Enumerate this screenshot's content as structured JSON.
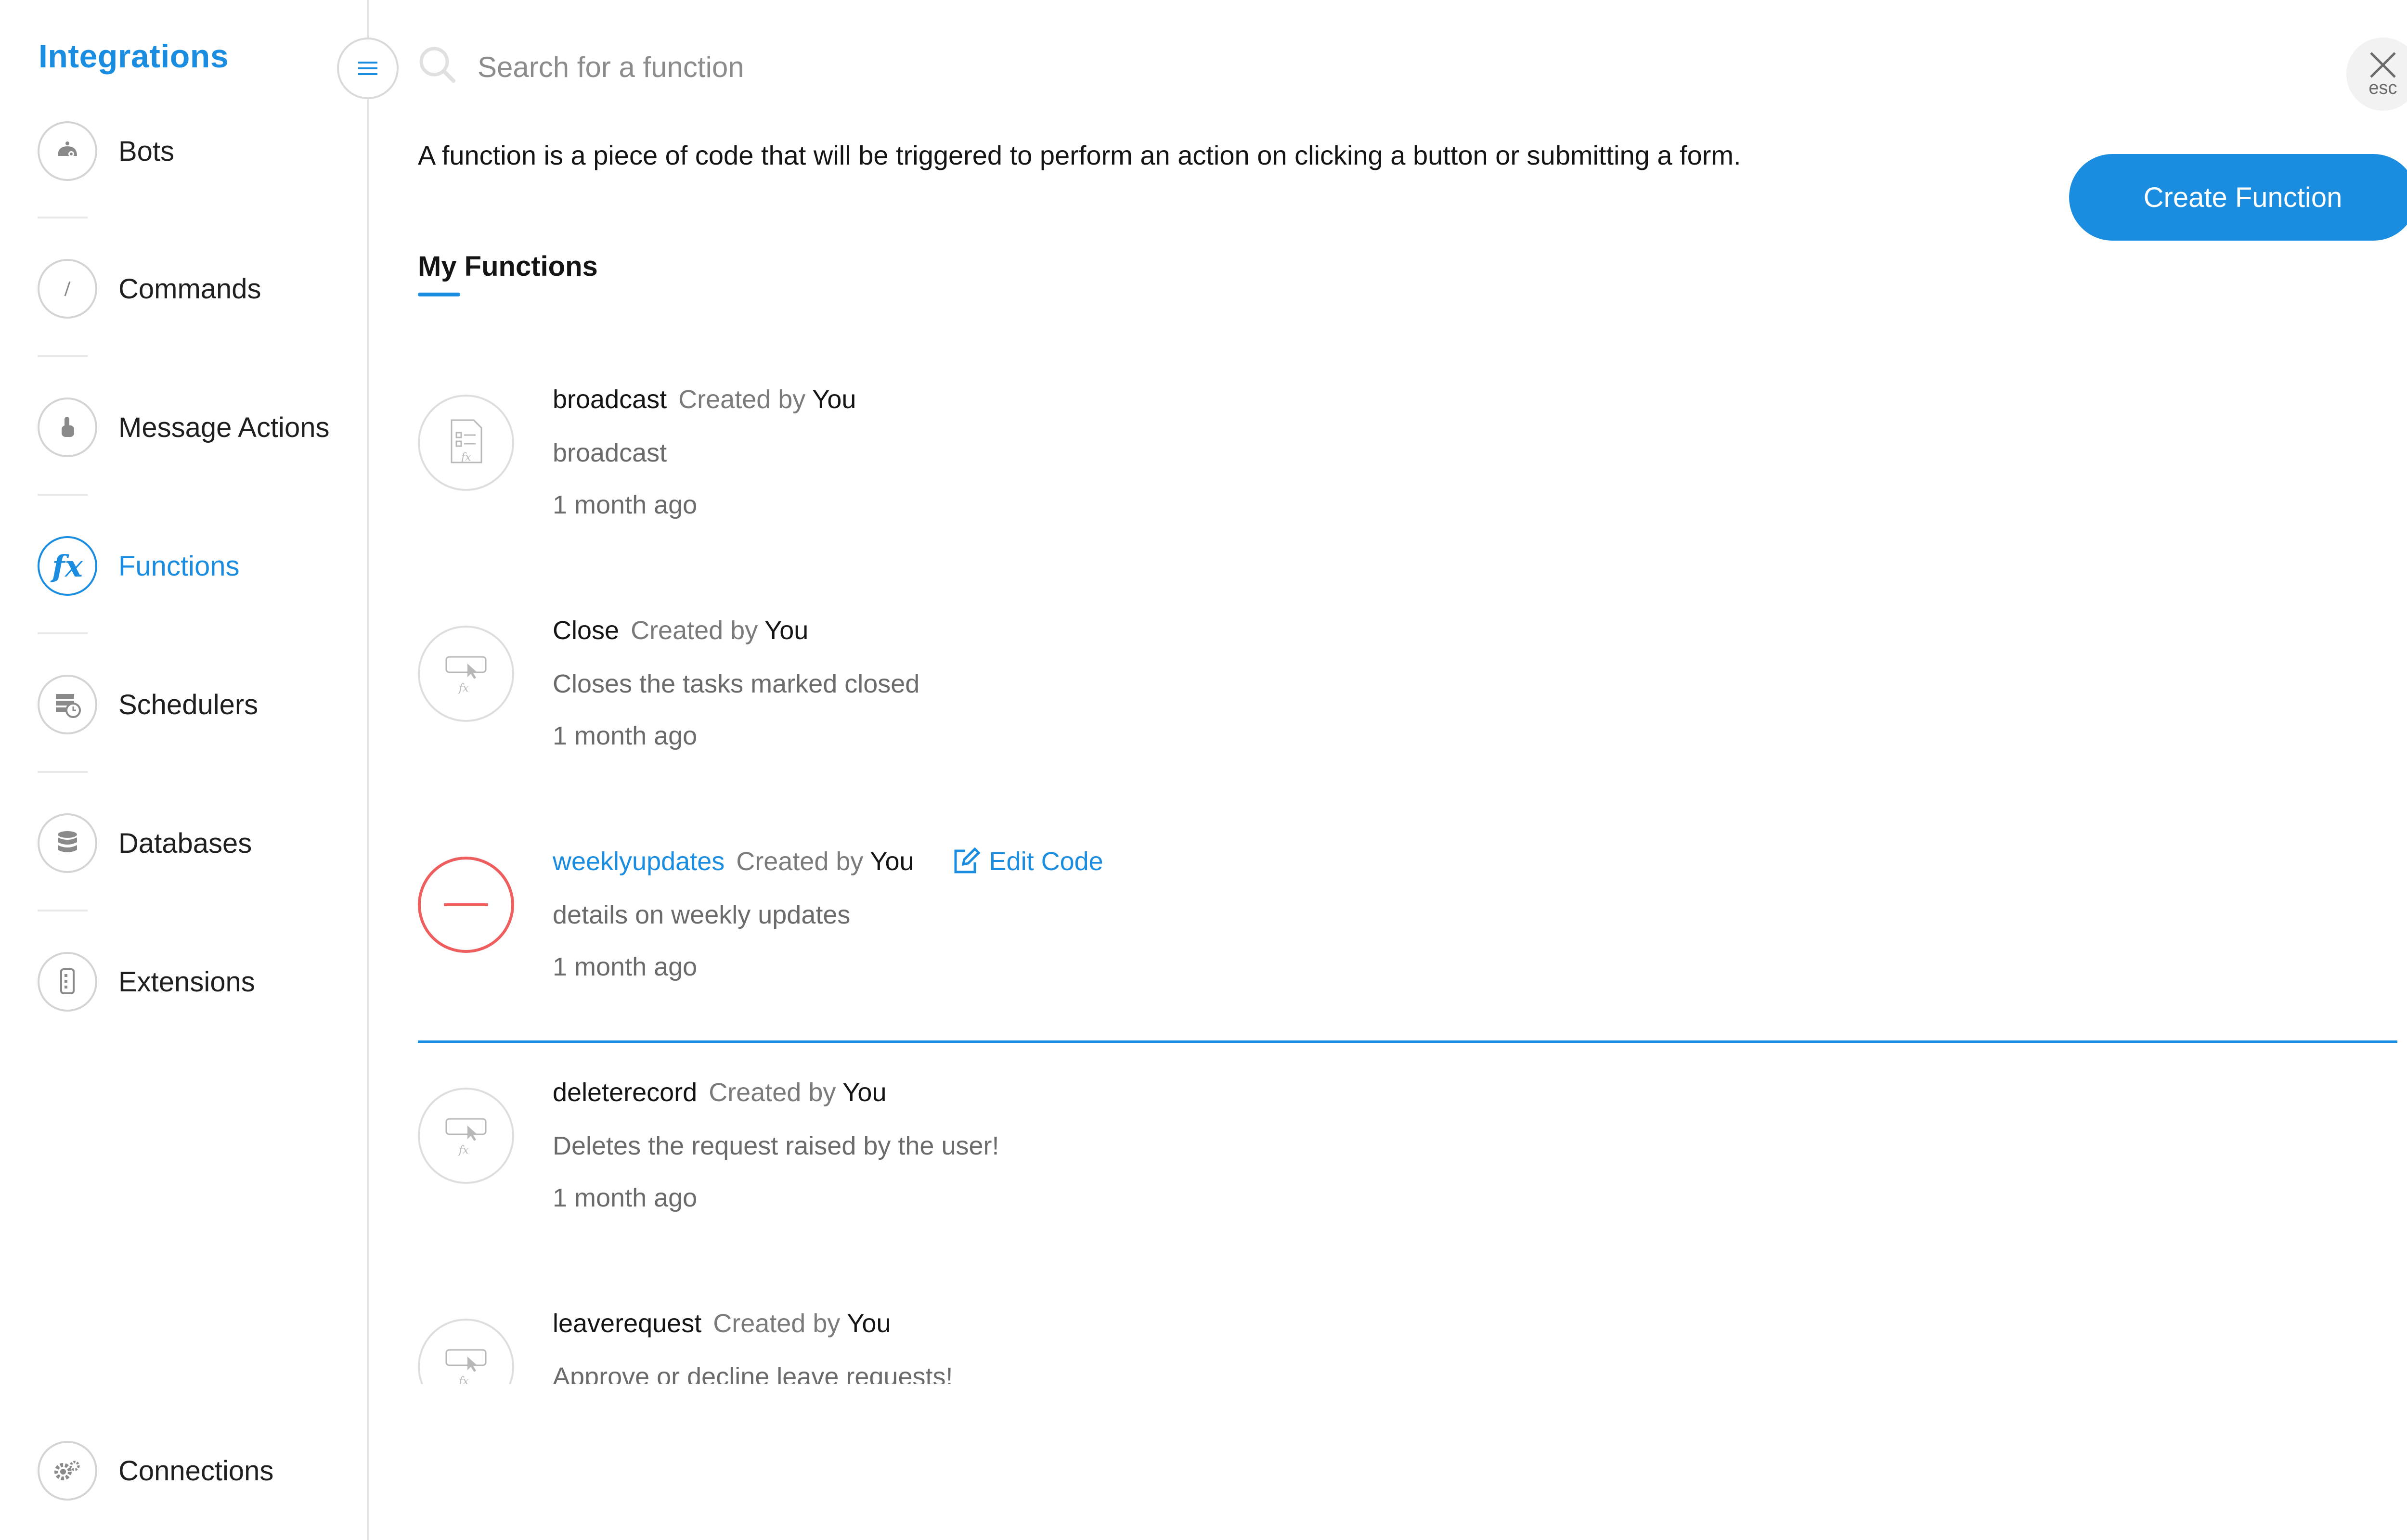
{
  "sidebar": {
    "title": "Integrations",
    "items": [
      {
        "label": "Bots",
        "icon": "bot-icon"
      },
      {
        "label": "Commands",
        "icon": "slash-icon"
      },
      {
        "label": "Message Actions",
        "icon": "hand-pointer-icon"
      },
      {
        "label": "Functions",
        "icon": "function-icon",
        "active": true
      },
      {
        "label": "Schedulers",
        "icon": "scheduler-icon"
      },
      {
        "label": "Databases",
        "icon": "database-icon"
      },
      {
        "label": "Extensions",
        "icon": "extension-icon"
      }
    ],
    "footer_item": {
      "label": "Connections",
      "icon": "gear-icon"
    }
  },
  "search": {
    "placeholder": "Search for a function"
  },
  "close": {
    "esc_label": "esc"
  },
  "intro_text": "A function is a piece of code that will be triggered to perform an action on clicking a button or submitting a form.",
  "create_button_label": "Create Function",
  "tab_label": "My Functions",
  "created_by_label": "Created by",
  "edit_code_label": "Edit Code",
  "functions": [
    {
      "name": "broadcast",
      "creator": "You",
      "description": "broadcast",
      "time": "1 month ago",
      "icon": "form-function-icon"
    },
    {
      "name": "Close",
      "creator": "You",
      "description": "Closes the tasks marked closed",
      "time": "1 month ago",
      "icon": "button-function-icon"
    },
    {
      "name": "weeklyupdates",
      "creator": "You",
      "description": "details on weekly updates",
      "time": "1 month ago",
      "icon": "remove-icon",
      "hovered": true
    },
    {
      "name": "deleterecord",
      "creator": "You",
      "description": "Deletes the request raised by the user!",
      "time": "1 month ago",
      "icon": "button-function-icon"
    },
    {
      "name": "leaverequest",
      "creator": "You",
      "description": "Approve or decline leave requests!",
      "time": "",
      "icon": "button-function-icon"
    }
  ],
  "colors": {
    "accent": "#1a8de0",
    "danger": "#ef5e5e"
  }
}
